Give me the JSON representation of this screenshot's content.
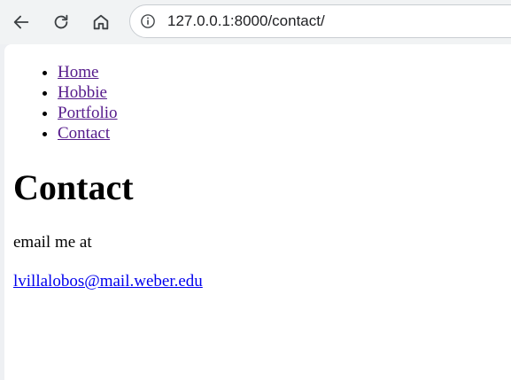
{
  "browser": {
    "url": "127.0.0.1:8000/contact/"
  },
  "nav": [
    {
      "label": "Home"
    },
    {
      "label": "Hobbie"
    },
    {
      "label": "Portfolio"
    },
    {
      "label": "Contact"
    }
  ],
  "content": {
    "heading": "Contact",
    "intro": "email me at",
    "email": "lvillalobos@mail.weber.edu"
  },
  "colors": {
    "visited_link": "#551a8b",
    "link": "#0000ee",
    "toolbar_bg": "#f1f3f4"
  }
}
